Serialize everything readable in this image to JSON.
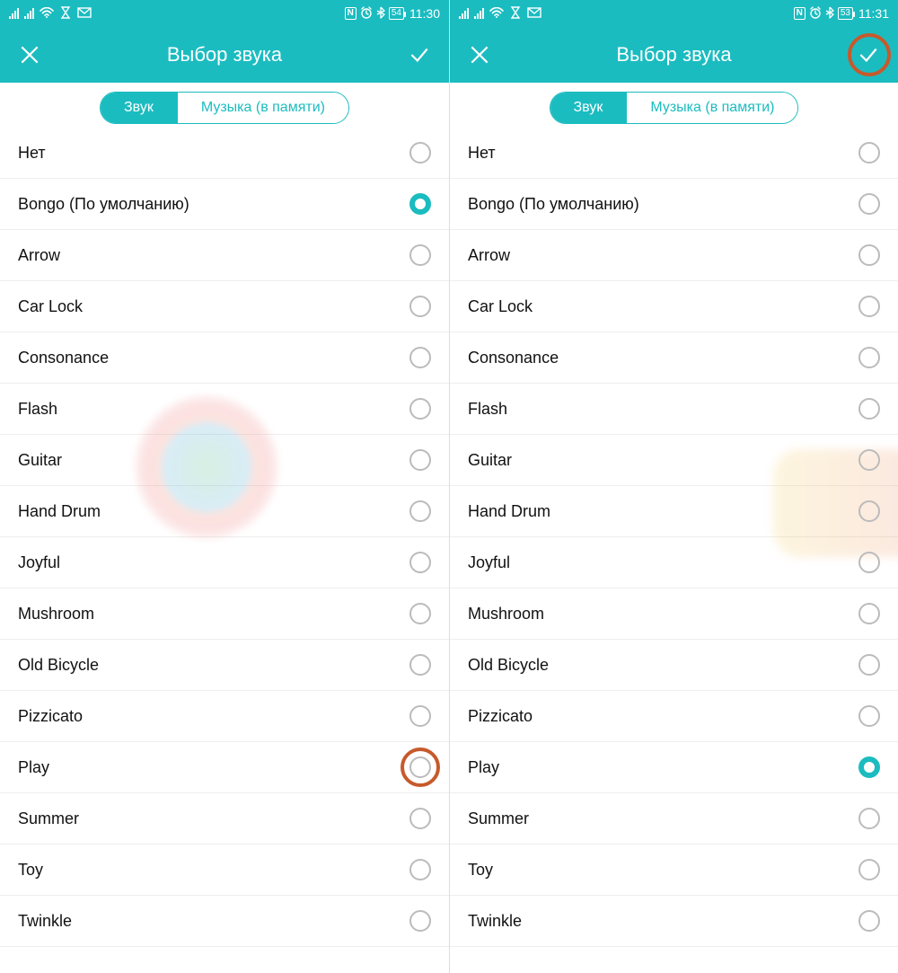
{
  "colors": {
    "accent": "#1bbcc0",
    "highlight": "#c65a2c"
  },
  "screens": [
    {
      "status": {
        "battery": "54",
        "time": "11:30"
      },
      "header": {
        "title": "Выбор звука"
      },
      "tabs": {
        "active": "Звук",
        "inactive": "Музыка (в памяти)"
      },
      "selected_index": 1,
      "highlight": {
        "target": "row-radio",
        "index": 12
      }
    },
    {
      "status": {
        "battery": "53",
        "time": "11:31"
      },
      "header": {
        "title": "Выбор звука"
      },
      "tabs": {
        "active": "Звук",
        "inactive": "Музыка (в памяти)"
      },
      "selected_index": 12,
      "highlight": {
        "target": "confirm-button"
      }
    }
  ],
  "sounds": [
    "Нет",
    "Bongo (По умолчанию)",
    "Arrow",
    "Car Lock",
    "Consonance",
    "Flash",
    "Guitar",
    "Hand Drum",
    "Joyful",
    "Mushroom",
    "Old Bicycle",
    "Pizzicato",
    "Play",
    "Summer",
    "Toy",
    "Twinkle"
  ]
}
